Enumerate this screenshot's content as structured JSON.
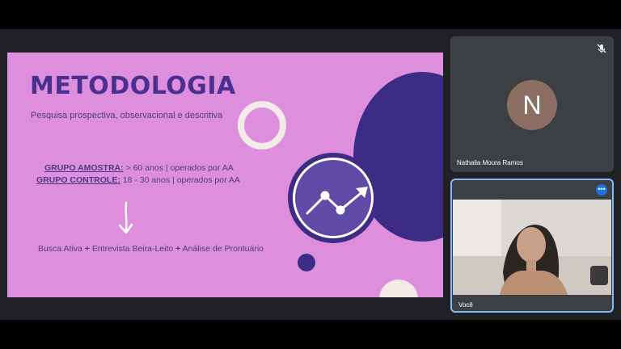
{
  "slide": {
    "title": "METODOLOGIA",
    "subtitle": "Pesquisa prospectiva, observacional e descritiva",
    "groups": [
      {
        "label": "GRUPO AMOSTRA:",
        "detail": " > 60 anos | operados por AA"
      },
      {
        "label": "GRUPO CONTROLE:",
        "detail": " 18 - 30 anos | operados por AA"
      }
    ],
    "methods": {
      "part1": "Busca Ativa ",
      "plus": "+",
      "part2": " Entrevista Beira-Leito ",
      "part3": " Análise de Prontuário"
    },
    "icons": {
      "chart": "trend-chart-icon",
      "arrow": "down-arrow-icon"
    },
    "colors": {
      "background": "#dd8fde",
      "accent": "#3d2c86",
      "text": "#4e3a84"
    }
  },
  "participants": {
    "remote": {
      "initial": "N",
      "name": "Nathalia Moura Ramos",
      "mic": "muted"
    },
    "self": {
      "name": "Você",
      "more_label": "•••"
    }
  }
}
